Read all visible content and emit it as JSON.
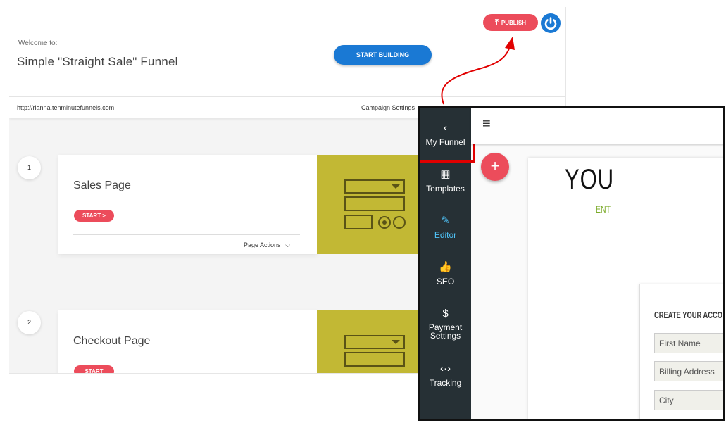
{
  "header": {
    "welcome": "Welcome to:",
    "funnel_title": "Simple \"Straight Sale\" Funnel",
    "start_building": "START BUILDING",
    "publish": "PUBLISH"
  },
  "urlbar": {
    "url": "http://rianna.tenminutefunnels.com",
    "campaign_settings": "Campaign Settings"
  },
  "steps": [
    {
      "number": "1",
      "name": "Sales Page",
      "start": "START >",
      "actions": "Page Actions"
    },
    {
      "number": "2",
      "name": "Checkout Page",
      "start": "START"
    }
  ],
  "editor": {
    "sidebar": [
      {
        "icon": "chevron-left-icon",
        "label": "My Funnel"
      },
      {
        "icon": "grid-icon",
        "label": "Templates"
      },
      {
        "icon": "pencil-icon",
        "label": "Editor"
      },
      {
        "icon": "thumbs-up-icon",
        "label": "SEO"
      },
      {
        "icon": "dollar-icon",
        "label": "Payment Settings"
      },
      {
        "icon": "code-icon",
        "label": "Tracking"
      }
    ],
    "hero_text": "YOU",
    "sub_text": "ENT",
    "form": {
      "heading": "CREATE YOUR ACCO",
      "fields": [
        "First Name",
        "Billing Address",
        "City"
      ]
    }
  },
  "colors": {
    "accent_blue": "#1a79d4",
    "publish_red": "#ec4c5b",
    "thumbnail_olive": "#c2b834",
    "sidebar_dark": "#263035",
    "highlight_red": "#e10000",
    "editor_active": "#4fc3f7"
  }
}
